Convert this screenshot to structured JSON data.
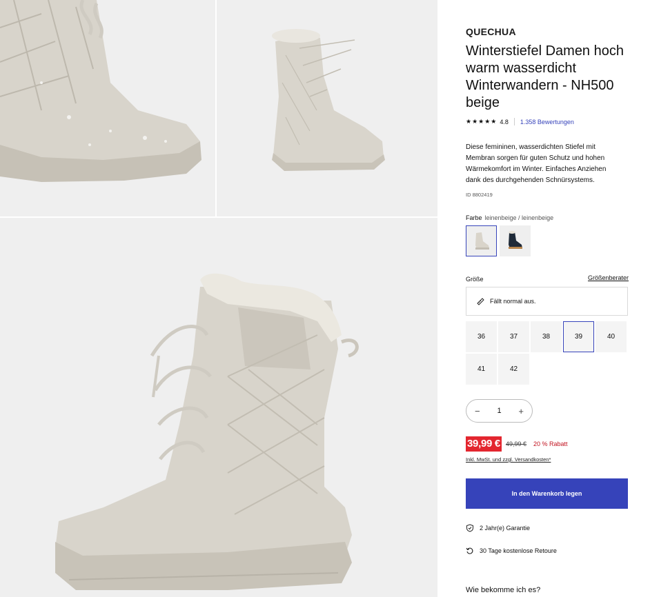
{
  "product": {
    "brand": "QUECHUA",
    "title": "Winterstiefel Damen hoch warm wasserdicht Winterwandern - NH500 beige",
    "stars": "★★★★★",
    "rating": "4.8",
    "reviews": "1.358 Bewertungen",
    "description": "Diese femininen, wasserdichten Stiefel mit Membran sorgen für guten Schutz und hohen Wärmekomfort im Winter. Einfaches Anziehen dank des durchgehenden Schnürsystems.",
    "id": "ID 8802419"
  },
  "color": {
    "label": "Farbe",
    "value": "leinenbeige / leinenbeige",
    "swatches": [
      {
        "name": "beige",
        "selected": true,
        "color": "#d9d4ca"
      },
      {
        "name": "navy",
        "selected": false,
        "color": "#1f2a38"
      }
    ]
  },
  "size": {
    "label": "Größe",
    "guide": "Größenberater",
    "fit": "Fällt normal aus.",
    "options": [
      "36",
      "37",
      "38",
      "39",
      "40",
      "41",
      "42"
    ],
    "selected": "39"
  },
  "quantity": {
    "minus": "−",
    "value": "1",
    "plus": "+"
  },
  "price": {
    "current": "39,99 €",
    "old": "49,99 €",
    "discount": "20 % Rabatt",
    "tax_note": "Inkl. MwSt. und zzgl. Versandkosten*"
  },
  "cart": {
    "label": "In den Warenkorb legen"
  },
  "services": [
    {
      "icon": "shield-check-icon",
      "label": "2 Jahr(e) Garantie"
    },
    {
      "icon": "return-arrow-icon",
      "label": "30 Tage kostenlose Retoure"
    }
  ],
  "delivery": {
    "question": "Wie bekomme ich es?"
  },
  "colors": {
    "accent": "#3643ba",
    "price_red": "#e3262f",
    "tile_bg": "#efefef",
    "boot": "#d6d2c8"
  }
}
